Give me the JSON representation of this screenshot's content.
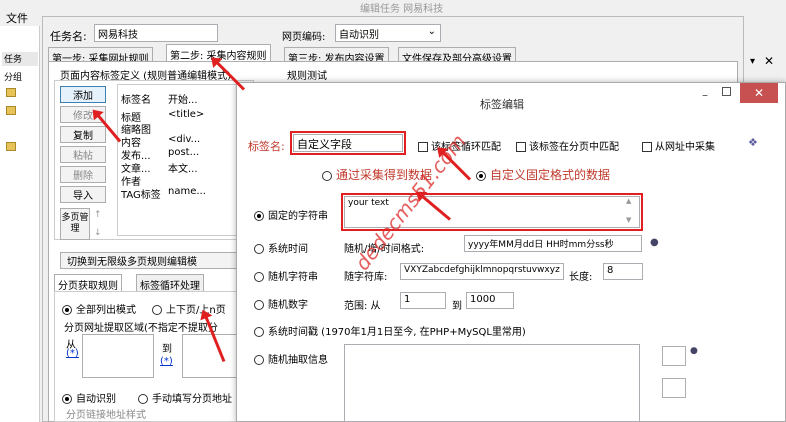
{
  "app": {
    "menu_file": "文件",
    "left_tabs": [
      "任务",
      "分组"
    ],
    "title_fragment": "编辑任务 网易科技"
  },
  "task": {
    "name_label": "任务名:",
    "name_value": "网易科技",
    "encoding_label": "网页编码:",
    "encoding_value": "自动识别"
  },
  "tabs": [
    "第一步: 采集网址规则",
    "第二步: 采集内容规则",
    "第三步: 发布内容设置",
    "文件保存及部分高级设置"
  ],
  "rules": {
    "group_title": "页面内容标签定义 (规则普通编辑模式)",
    "test_label": "规则测试",
    "buttons": [
      "添加",
      "修改",
      "复制",
      "粘帖",
      "删除",
      "导入",
      "多页管理"
    ],
    "columns": [
      "标签名",
      "开始..."
    ],
    "rows": [
      [
        "标题",
        "<title>"
      ],
      [
        "缩略图",
        ""
      ],
      [
        "内容",
        "<div..."
      ],
      [
        "发布...",
        "post..."
      ],
      [
        "文章...",
        "本文..."
      ],
      [
        "作者",
        ""
      ],
      [
        "TAG标签",
        "name..."
      ]
    ],
    "switch_btn": "切换到无限级多页规则编辑模"
  },
  "paging": {
    "tabs": [
      "分页获取规则",
      "标签循环处理"
    ],
    "opt_all": "全部列出模式",
    "opt_updown": "上下页/上n页",
    "region_label": "分页网址提取区域(不指定不提取分",
    "from": "从",
    "to": "到",
    "star": "(*)",
    "auto": "自动识别",
    "manual": "手动填写分页地址",
    "link_style": "分页链接地址样式"
  },
  "dialog": {
    "title": "标签编辑",
    "name_label": "标签名:",
    "name_value": "自定义字段",
    "chk_loop": "该标签循环匹配",
    "chk_page": "该标签在分页中匹配",
    "chk_url": "从网址中采集",
    "mode_collect": "通过采集得到数据",
    "mode_fixed": "自定义固定格式的数据",
    "fixed_label": "固定的字符串",
    "fixed_value": "your text",
    "systime_label": "系统时间",
    "systime_mid": "随机/增/时间格式:",
    "systime_value": "yyyy年MM月dd日 HH时mm分ss秒",
    "randstr_label": "随机字符串",
    "randstr_mid": "随字符库:",
    "randstr_value": "VXYZabcdefghijklmnopqrstuvwxyz",
    "len_label": "长度:",
    "len_value": "8",
    "randnum_label": "随机数字",
    "range_label": "范围: 从",
    "range_from": "1",
    "range_to_label": "到",
    "range_to": "1000",
    "stamp_label": "系统时间戳 (1970年1月1日至今, 在PHP+MySQL里常用)",
    "randinfo_label": "随机抽取信息"
  },
  "watermark": "dedecms51.com",
  "colors": {
    "accent_red": "#e02020",
    "title_red": "#c0392b"
  }
}
